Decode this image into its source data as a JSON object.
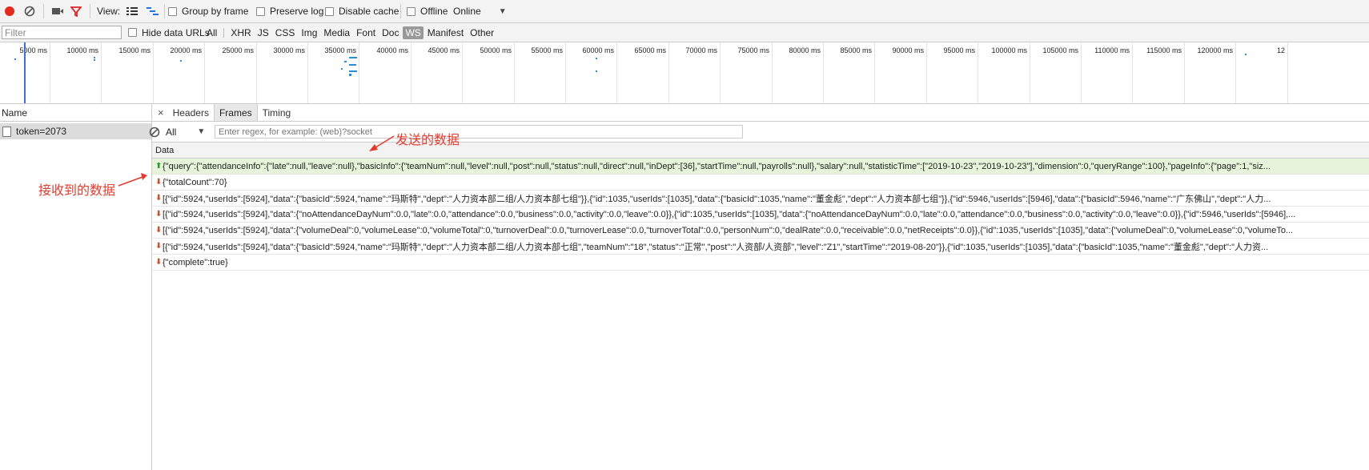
{
  "toolbar": {
    "view_label": "View:",
    "group_by_frame": "Group by frame",
    "preserve_log": "Preserve log",
    "disable_cache": "Disable cache",
    "offline": "Offline",
    "online": "Online",
    "record_color": "#e22a1e",
    "filter_color": "#d9262b"
  },
  "filterbar": {
    "placeholder": "Filter",
    "hide_data_urls": "Hide data URLs",
    "types": [
      "All",
      "XHR",
      "JS",
      "CSS",
      "Img",
      "Media",
      "Font",
      "Doc",
      "WS",
      "Manifest",
      "Other"
    ],
    "active_type": "WS"
  },
  "overview": {
    "ticks": [
      "5000 ms",
      "10000 ms",
      "15000 ms",
      "20000 ms",
      "25000 ms",
      "30000 ms",
      "35000 ms",
      "40000 ms",
      "45000 ms",
      "50000 ms",
      "55000 ms",
      "60000 ms",
      "65000 ms",
      "70000 ms",
      "75000 ms",
      "80000 ms",
      "85000 ms",
      "90000 ms",
      "95000 ms",
      "100000 ms",
      "105000 ms",
      "110000 ms",
      "115000 ms",
      "120000 ms",
      "12"
    ]
  },
  "sidebar": {
    "header": "Name",
    "request": "token=2073"
  },
  "detail": {
    "close": "×",
    "tabs": [
      "Headers",
      "Frames",
      "Timing"
    ],
    "selected_tab": "Frames",
    "frames_filter_all": "All",
    "regex_placeholder": "Enter regex, for example: (web)?socket",
    "data_header": "Data",
    "frames": [
      {
        "dir": "sent",
        "text": "{\"query\":{\"attendanceInfo\":{\"late\":null,\"leave\":null},\"basicInfo\":{\"teamNum\":null,\"level\":null,\"post\":null,\"status\":null,\"direct\":null,\"inDept\":[36],\"startTime\":null,\"payrolls\":null},\"salary\":null,\"statisticTime\":[\"2019-10-23\",\"2019-10-23\"],\"dimension\":0,\"queryRange\":100},\"pageInfo\":{\"page\":1,\"siz..."
      },
      {
        "dir": "received",
        "text": "{\"totalCount\":70}"
      },
      {
        "dir": "received",
        "text": "[{\"id\":5924,\"userIds\":[5924],\"data\":{\"basicId\":5924,\"name\":\"玛斯特\",\"dept\":\"人力资本部二组/人力资本部七组\"}},{\"id\":1035,\"userIds\":[1035],\"data\":{\"basicId\":1035,\"name\":\"董金彪\",\"dept\":\"人力资本部七组\"}},{\"id\":5946,\"userIds\":[5946],\"data\":{\"basicId\":5946,\"name\":\"广东佛山\",\"dept\":\"人力..."
      },
      {
        "dir": "received",
        "text": "[{\"id\":5924,\"userIds\":[5924],\"data\":{\"noAttendanceDayNum\":0.0,\"late\":0.0,\"attendance\":0.0,\"business\":0.0,\"activity\":0.0,\"leave\":0.0}},{\"id\":1035,\"userIds\":[1035],\"data\":{\"noAttendanceDayNum\":0.0,\"late\":0.0,\"attendance\":0.0,\"business\":0.0,\"activity\":0.0,\"leave\":0.0}},{\"id\":5946,\"userIds\":[5946],..."
      },
      {
        "dir": "received",
        "text": "[{\"id\":5924,\"userIds\":[5924],\"data\":{\"volumeDeal\":0,\"volumeLease\":0,\"volumeTotal\":0,\"turnoverDeal\":0.0,\"turnoverLease\":0.0,\"turnoverTotal\":0.0,\"personNum\":0,\"dealRate\":0.0,\"receivable\":0.0,\"netReceipts\":0.0}},{\"id\":1035,\"userIds\":[1035],\"data\":{\"volumeDeal\":0,\"volumeLease\":0,\"volumeTo..."
      },
      {
        "dir": "received",
        "text": "[{\"id\":5924,\"userIds\":[5924],\"data\":{\"basicId\":5924,\"name\":\"玛斯特\",\"dept\":\"人力资本部二组/人力资本部七组\",\"teamNum\":\"18\",\"status\":\"正常\",\"post\":\"人资部/人资部\",\"level\":\"Z1\",\"startTime\":\"2019-08-20\"}},{\"id\":1035,\"userIds\":[1035],\"data\":{\"basicId\":1035,\"name\":\"董金彪\",\"dept\":\"人力资..."
      },
      {
        "dir": "received",
        "text": "{\"complete\":true}"
      }
    ]
  },
  "annotations": {
    "sent": "发送的数据",
    "received": "接收到的数据",
    "color": "#e23b2e"
  }
}
